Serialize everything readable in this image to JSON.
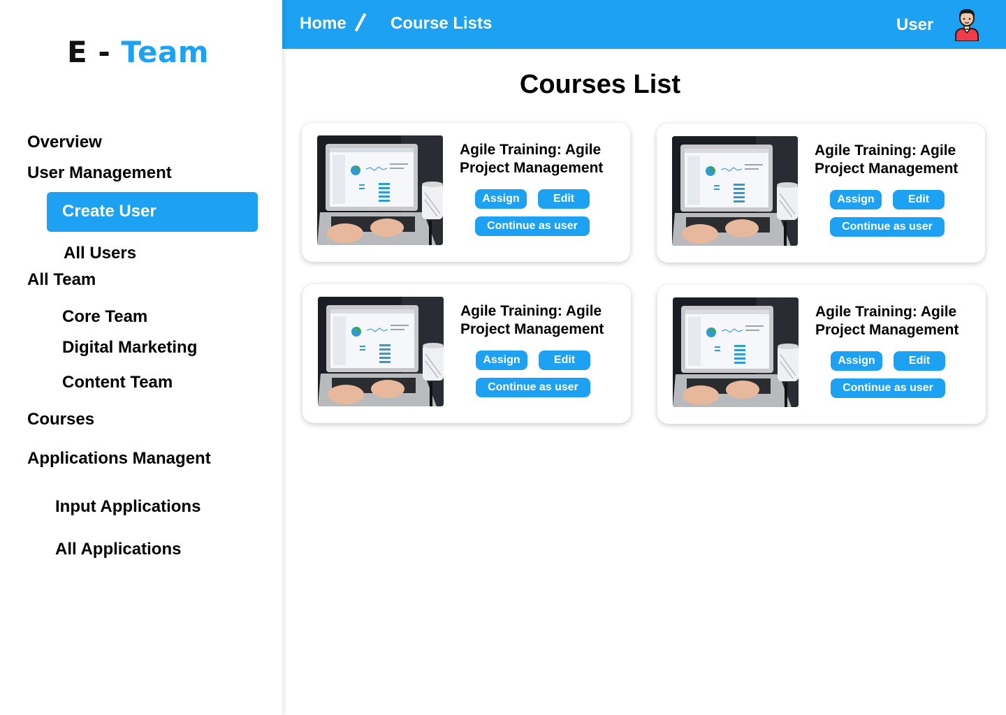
{
  "logo": {
    "part1": "E - ",
    "part2": "Team"
  },
  "sidebar": {
    "overview": "Overview",
    "user_management": "User Management",
    "create_user": "Create User",
    "all_users": "All Users",
    "all_team": "All Team",
    "core_team": "Core Team",
    "digital_marketing": "Digital Marketing",
    "content_team": "Content Team",
    "courses": "Courses",
    "applications_management": "Applications Managent",
    "input_applications": "Input Applications",
    "all_applications": "All Applications"
  },
  "header": {
    "home": "Home",
    "current": "Course Lists",
    "user_label": "User"
  },
  "page_title": "Courses List",
  "courses": [
    {
      "title": "Agile Training: Agile Project Management",
      "assign": "Assign",
      "edit": "Edit",
      "continue": "Continue as user"
    },
    {
      "title": "Agile Training: Agile Project Management",
      "assign": "Assign",
      "edit": "Edit",
      "continue": "Continue as user"
    },
    {
      "title": "Agile Training: Agile Project Management",
      "assign": "Assign",
      "edit": "Edit",
      "continue": "Continue as user"
    },
    {
      "title": "Agile Training: Agile Project Management",
      "assign": "Assign",
      "edit": "Edit",
      "continue": "Continue as user"
    }
  ],
  "colors": {
    "accent": "#1da1f2",
    "background": "#ffffff",
    "text": "#000000"
  }
}
